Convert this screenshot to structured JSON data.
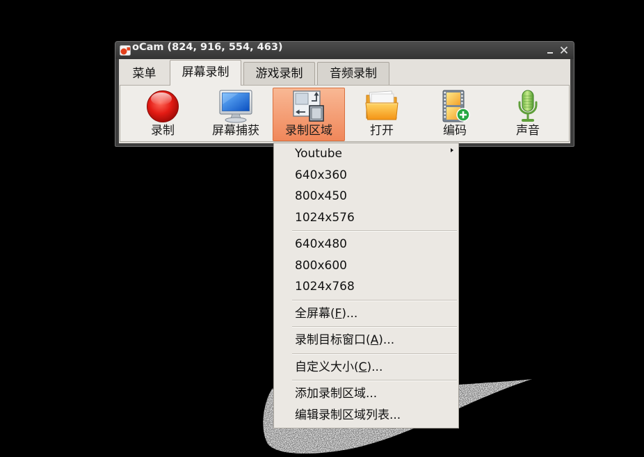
{
  "window": {
    "title": "oCam (824, 916, 554, 463)",
    "app_icon": "ocam-app-icon",
    "minimize_icon": "minimize-icon",
    "close_icon": "close-icon"
  },
  "tabs": [
    {
      "label": "菜单",
      "selected": false
    },
    {
      "label": "屏幕录制",
      "selected": true
    },
    {
      "label": "游戏录制",
      "selected": false
    },
    {
      "label": "音频录制",
      "selected": false
    }
  ],
  "toolbar": {
    "buttons": [
      {
        "label": "录制",
        "icon": "record-icon",
        "active": false
      },
      {
        "label": "屏幕捕获",
        "icon": "monitor-icon",
        "active": false
      },
      {
        "label": "录制区域",
        "icon": "record-area-icon",
        "active": true
      },
      {
        "label": "打开",
        "icon": "folder-icon",
        "active": false
      },
      {
        "label": "编码",
        "icon": "film-add-icon",
        "active": false
      },
      {
        "label": "声音",
        "icon": "microphone-icon",
        "active": false
      }
    ]
  },
  "region_menu": {
    "items": [
      {
        "label": "Youtube",
        "submenu": true,
        "submenu_icon": "submenu-arrow-icon"
      },
      {
        "label": "640x360"
      },
      {
        "label": "800x450"
      },
      {
        "label": "1024x576"
      },
      {
        "label": "640x480"
      },
      {
        "label": "800x600"
      },
      {
        "label": "1024x768"
      },
      {
        "label": "全屏幕(",
        "mnemonic": "F",
        "suffix": ")..."
      },
      {
        "label": "录制目标窗口(",
        "mnemonic": "A",
        "suffix": ")..."
      },
      {
        "label": "自定义大小(",
        "mnemonic": "C",
        "suffix": ")..."
      },
      {
        "label": "添加录制区域..."
      },
      {
        "label": "编辑录制区域列表..."
      }
    ]
  },
  "colors": {
    "titlebar": "#343434",
    "frame": "#3d3d3d",
    "client_bg": "#e4e1dc",
    "panel_bg": "#efede9",
    "tab_inactive_bg": "#d7d4ce",
    "active_button_top": "#f9b894",
    "active_button_bottom": "#f0875a",
    "active_button_border": "#d9703f",
    "menu_bg": "#ebe8e3"
  }
}
